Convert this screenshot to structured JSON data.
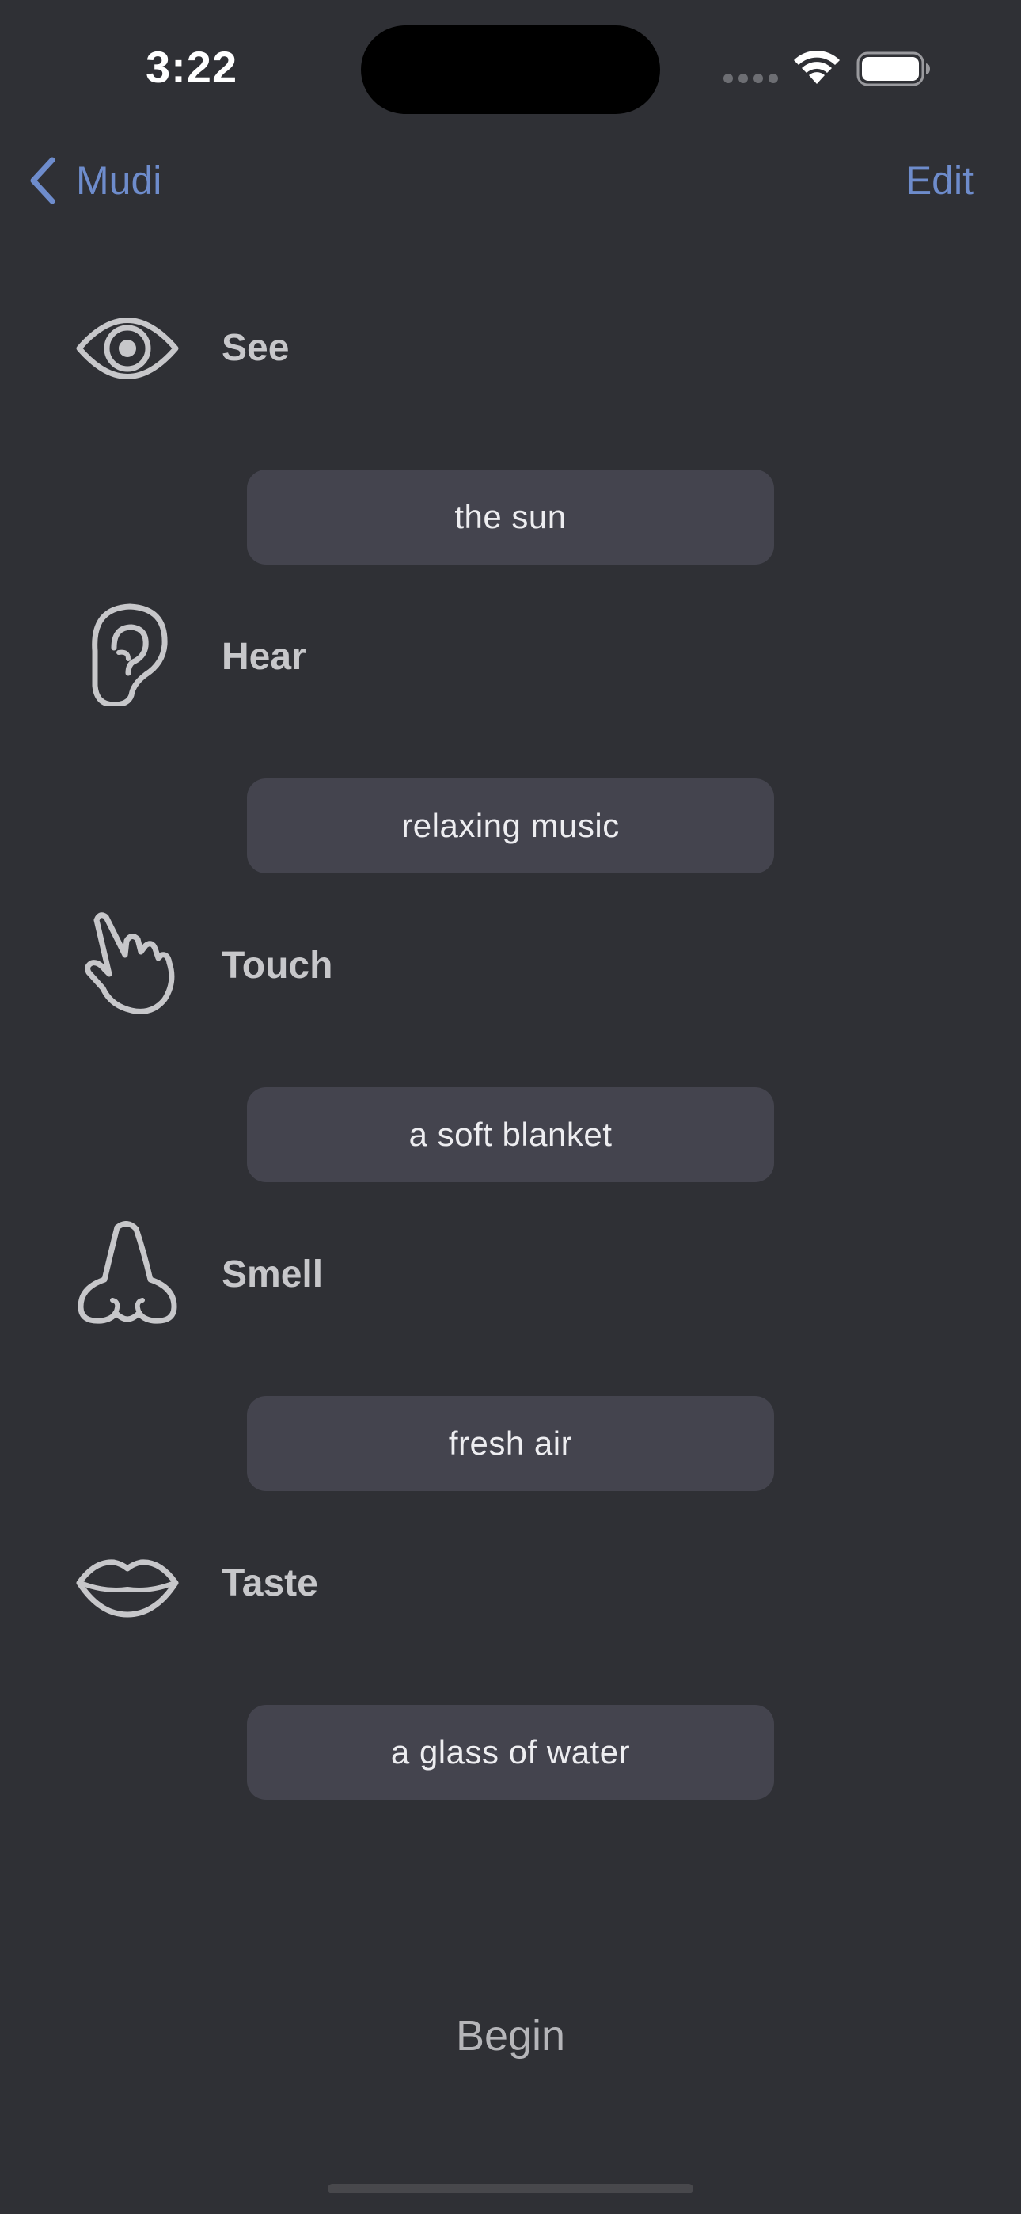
{
  "status_bar": {
    "time": "3:22",
    "icons": [
      "signal-icon",
      "wifi-icon",
      "battery-icon"
    ]
  },
  "nav": {
    "back_label": "Mudi",
    "edit_label": "Edit",
    "accent_color": "#6e8ccc"
  },
  "senses": [
    {
      "label": "See",
      "icon": "eye-icon",
      "value": "the sun"
    },
    {
      "label": "Hear",
      "icon": "ear-icon",
      "value": "relaxing music"
    },
    {
      "label": "Touch",
      "icon": "hand-pointer-icon",
      "value": "a soft blanket"
    },
    {
      "label": "Smell",
      "icon": "nose-icon",
      "value": "fresh air"
    },
    {
      "label": "Taste",
      "icon": "lips-icon",
      "value": "a glass of water"
    }
  ],
  "begin_label": "Begin"
}
